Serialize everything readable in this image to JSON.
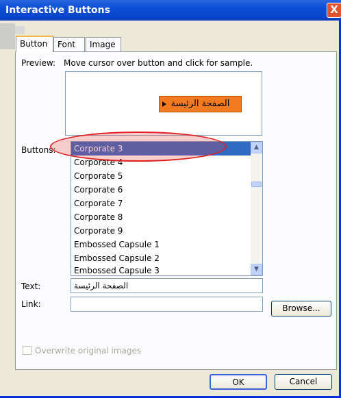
{
  "window": {
    "title": "Interactive Buttons",
    "close_glyph": "X"
  },
  "tabs": [
    {
      "label": "Button",
      "active": true
    },
    {
      "label": "Font",
      "active": false
    },
    {
      "label": "Image",
      "active": false
    }
  ],
  "preview": {
    "label": "Preview:",
    "hint": "Move cursor over button and click for sample.",
    "sample_text": "الصفحة الرئيسة",
    "sample_color": "#f47a20"
  },
  "buttons": {
    "label": "Buttons:",
    "items": [
      "Corporate 3",
      "Corporate 4",
      "Corporate 5",
      "Corporate 6",
      "Corporate 7",
      "Corporate 8",
      "Corporate 9",
      "Embossed Capsule 1",
      "Embossed Capsule 2",
      "Embossed Capsule 3"
    ],
    "selected": "Corporate 3"
  },
  "text_field": {
    "label": "Text:",
    "value": "الصفحة الرئيسة"
  },
  "link_field": {
    "label": "Link:",
    "value": ""
  },
  "browse_label": "Browse...",
  "overwrite_label": "Overwrite original images",
  "ok_label": "OK",
  "cancel_label": "Cancel",
  "colors": {
    "selection": "#316ac5",
    "titlebar": "#0a4ed8",
    "highlight": "#e02020"
  }
}
